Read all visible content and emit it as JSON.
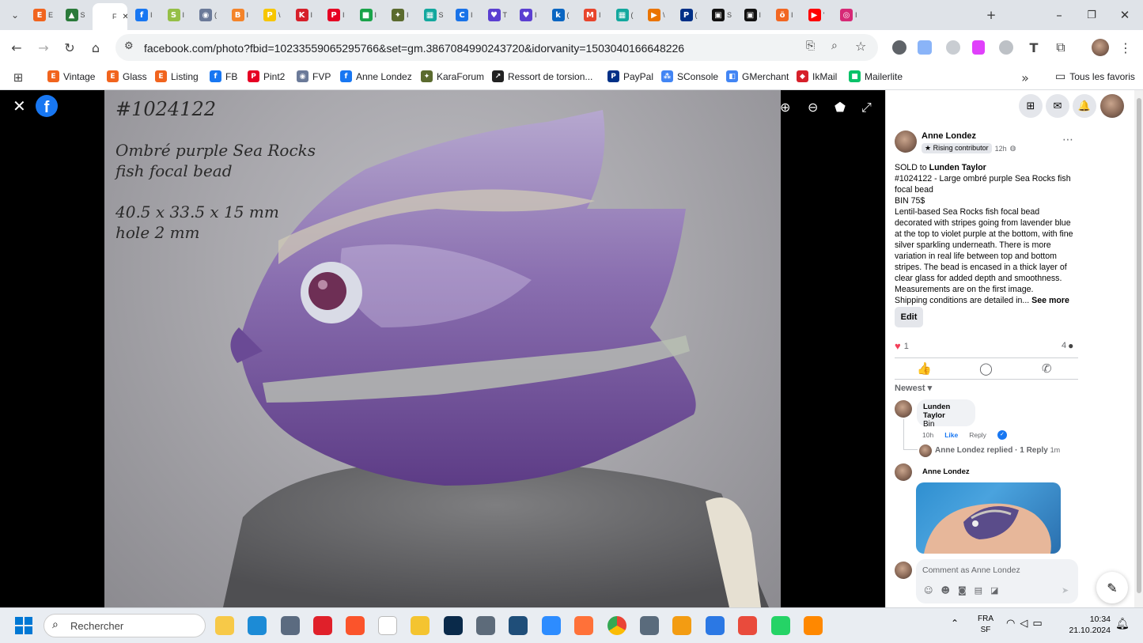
{
  "browser": {
    "tabs": [
      {
        "favicon_text": "E",
        "color": "#f1641e",
        "label": "E"
      },
      {
        "favicon_text": "▲",
        "color": "#2a7a3a",
        "label": "S"
      },
      {
        "favicon_text": "",
        "color": "#ffffff",
        "label": "F",
        "active": true
      },
      {
        "favicon_text": "f",
        "color": "#1877f2",
        "label": "I"
      },
      {
        "favicon_text": "S",
        "color": "#95bf47",
        "label": "I"
      },
      {
        "favicon_text": "◉",
        "color": "#6b7a99",
        "label": "("
      },
      {
        "favicon_text": "B",
        "color": "#f4842a",
        "label": "I"
      },
      {
        "favicon_text": "P",
        "color": "#f7c600",
        "label": "\\"
      },
      {
        "favicon_text": "K",
        "color": "#d6202a",
        "label": "I"
      },
      {
        "favicon_text": "P",
        "color": "#e60023",
        "label": "I"
      },
      {
        "favicon_text": "■",
        "color": "#1aa34a",
        "label": "I"
      },
      {
        "favicon_text": "✦",
        "color": "#5b6b2f",
        "label": "I"
      },
      {
        "favicon_text": "▦",
        "color": "#13a89e",
        "label": "S"
      },
      {
        "favicon_text": "C",
        "color": "#1a73e8",
        "label": "I"
      },
      {
        "favicon_text": "♥",
        "color": "#5b3fd1",
        "label": "T"
      },
      {
        "favicon_text": "♥",
        "color": "#5b3fd1",
        "label": "I"
      },
      {
        "favicon_text": "k",
        "color": "#0a66c2",
        "label": "("
      },
      {
        "favicon_text": "M",
        "color": "#e8452c",
        "label": "I"
      },
      {
        "favicon_text": "▦",
        "color": "#13a89e",
        "label": "("
      },
      {
        "favicon_text": "▶",
        "color": "#ea7400",
        "label": "\\"
      },
      {
        "favicon_text": "P",
        "color": "#003087",
        "label": "("
      },
      {
        "favicon_text": "▣",
        "color": "#111111",
        "label": "S"
      },
      {
        "favicon_text": "▣",
        "color": "#111111",
        "label": "I"
      },
      {
        "favicon_text": "ö",
        "color": "#f26722",
        "label": "I"
      },
      {
        "favicon_text": "▶",
        "color": "#ff0000",
        "label": "'"
      },
      {
        "favicon_text": "◎",
        "color": "#d62976",
        "label": "I"
      }
    ],
    "url": "facebook.com/photo?fbid=10233559065295766&set=gm.3867084990243720&idorvanity=1503040166648226",
    "bookmarks": [
      {
        "label": "Vintage",
        "favicon_text": "E",
        "color": "#f1641e"
      },
      {
        "label": "Glass",
        "favicon_text": "E",
        "color": "#f1641e"
      },
      {
        "label": "Listing",
        "favicon_text": "E",
        "color": "#f1641e"
      },
      {
        "label": "FB",
        "favicon_text": "f",
        "color": "#1877f2"
      },
      {
        "label": "Pint2",
        "favicon_text": "P",
        "color": "#e60023"
      },
      {
        "label": "FVP",
        "favicon_text": "◉",
        "color": "#6b7a99"
      },
      {
        "label": "Anne Londez",
        "favicon_text": "f",
        "color": "#1877f2"
      },
      {
        "label": "KaraForum",
        "favicon_text": "✦",
        "color": "#5b6b2f"
      },
      {
        "label": "Ressort de torsion...",
        "favicon_text": "↗",
        "color": "#222222"
      },
      {
        "label": "PayPal",
        "favicon_text": "P",
        "color": "#003087"
      },
      {
        "label": "SConsole",
        "favicon_text": "⁂",
        "color": "#4285f4"
      },
      {
        "label": "GMerchant",
        "favicon_text": "◧",
        "color": "#4285f4"
      },
      {
        "label": "IkMail",
        "favicon_text": "◆",
        "color": "#d6202a"
      },
      {
        "label": "Mailerlite",
        "favicon_text": "■",
        "color": "#09c269"
      }
    ],
    "all_bookmarks_label": "Tous les favoris"
  },
  "photo": {
    "line1": "#1024122",
    "line2": "Ombré purple Sea Rocks",
    "line3": "fish focal bead",
    "line4": "40.5 x 33.5 x 15 mm",
    "line5": "hole 2 mm"
  },
  "post": {
    "author": "Anne Londez",
    "badge": "Rising contributor",
    "time": "12h",
    "sold_prefix": "SOLD to",
    "sold_to": "Lunden Taylor",
    "text1": "#1024122 - Large ombré purple Sea Rocks fish focal bead",
    "text2": "BIN 75$",
    "text3": "Lentil-based Sea Rocks fish focal bead decorated with stripes going from lavender blue at the top to violet purple at the bottom, with fine silver sparkling underneath. There is more variation in real life between top and bottom stripes. The bead is encased in a thick layer of clear glass for added depth and smoothness.",
    "text4": "Measurements are on the first image.",
    "text5": "Shipping conditions are detailed in...",
    "see_more": "See more",
    "edit_label": "Edit",
    "reactions_count": "1",
    "comments_count": "4",
    "sort_label": "Newest"
  },
  "comments": [
    {
      "author": "Lunden Taylor",
      "text": "Bin",
      "time": "10h",
      "like": "Like",
      "reply": "Reply"
    },
    {
      "author": "Anne Londez",
      "replied_text": "Anne Londez replied · 1 Reply",
      "replied_time": "1m"
    },
    {
      "author": "Anne Londez"
    }
  ],
  "comment_box": {
    "placeholder": "Comment as Anne Londez"
  },
  "taskbar": {
    "search_placeholder": "Rechercher",
    "lang1": "FRA",
    "lang2": "SF",
    "time": "10:34",
    "date": "21.10.2024"
  }
}
